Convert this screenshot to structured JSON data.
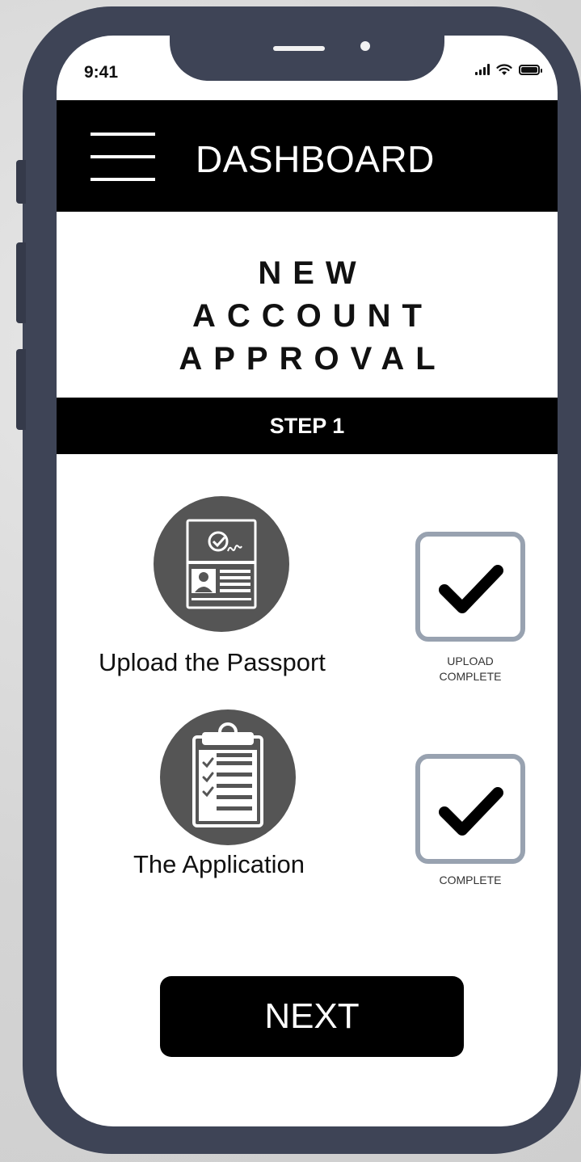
{
  "status_bar": {
    "time": "9:41"
  },
  "header": {
    "title": "DASHBOARD"
  },
  "page": {
    "title_lines": [
      "NEW",
      "ACCOUNT",
      "APPROVAL"
    ],
    "step_label": "STEP 1"
  },
  "items": [
    {
      "label": "Upload the Passport",
      "status_lines": [
        "UPLOAD",
        "COMPLETE"
      ],
      "icon": "passport-icon",
      "checked": true
    },
    {
      "label": "The Application",
      "status_lines": [
        "COMPLETE"
      ],
      "icon": "clipboard-icon",
      "checked": true
    }
  ],
  "next_button": {
    "label": "NEXT"
  },
  "colors": {
    "phone_frame": "#3e4456",
    "header_bg": "#000000",
    "icon_circle": "#555555",
    "checkbox_border": "#98a2b0"
  }
}
